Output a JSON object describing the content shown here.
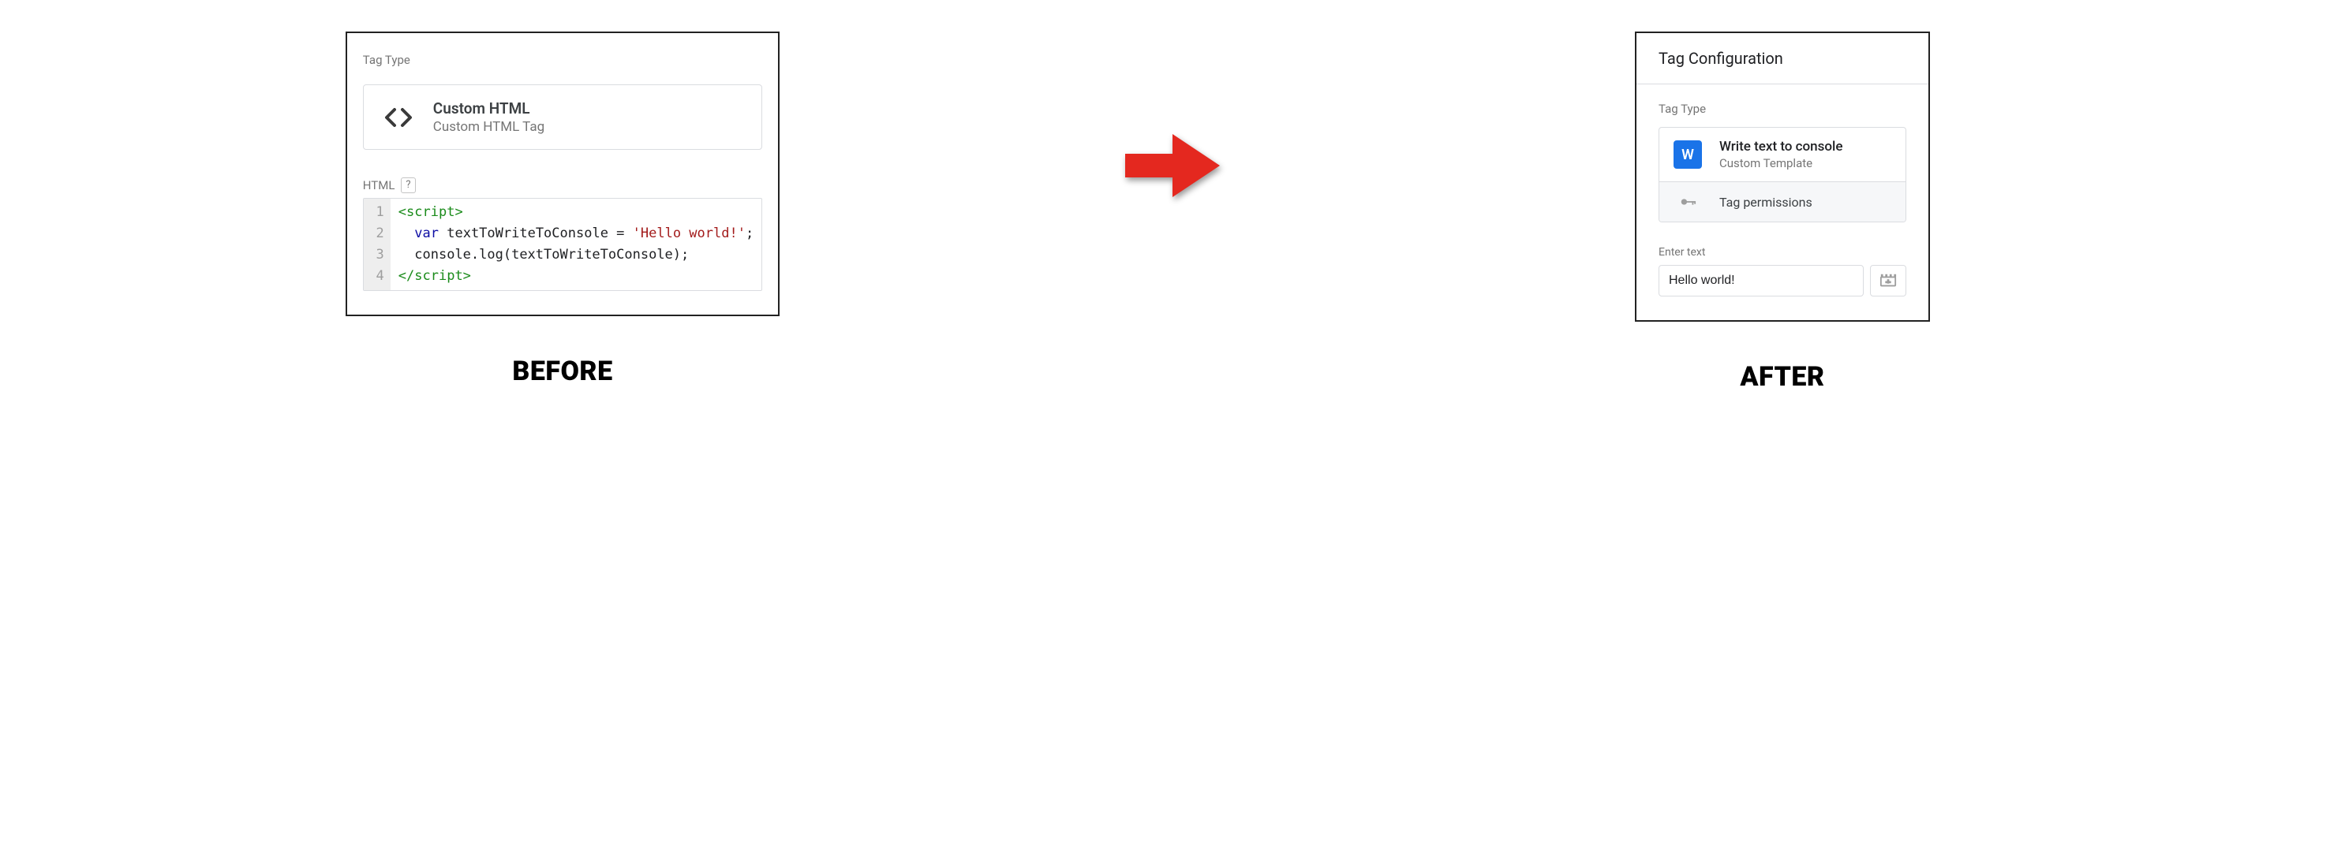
{
  "captions": {
    "before": "BEFORE",
    "after": "AFTER"
  },
  "before": {
    "section_label": "Tag Type",
    "type_title": "Custom HTML",
    "type_sub": "Custom HTML Tag",
    "html_label": "HTML",
    "help_glyph": "?",
    "line_numbers": [
      "1",
      "2",
      "3",
      "4"
    ],
    "code": {
      "l1a": "<script>",
      "l2a": "  ",
      "l2b": "var",
      "l2c": " textToWriteToConsole = ",
      "l2d": "'Hello world!'",
      "l2e": ";",
      "l3a": "  console.log(textToWriteToConsole);",
      "l4a": "</script>"
    }
  },
  "after": {
    "header": "Tag Configuration",
    "section_label": "Tag Type",
    "type_title": "Write text to console",
    "type_sub": "Custom Template",
    "type_icon_letter": "W",
    "permissions_label": "Tag permissions",
    "field_label": "Enter text",
    "field_value": "Hello world!"
  }
}
